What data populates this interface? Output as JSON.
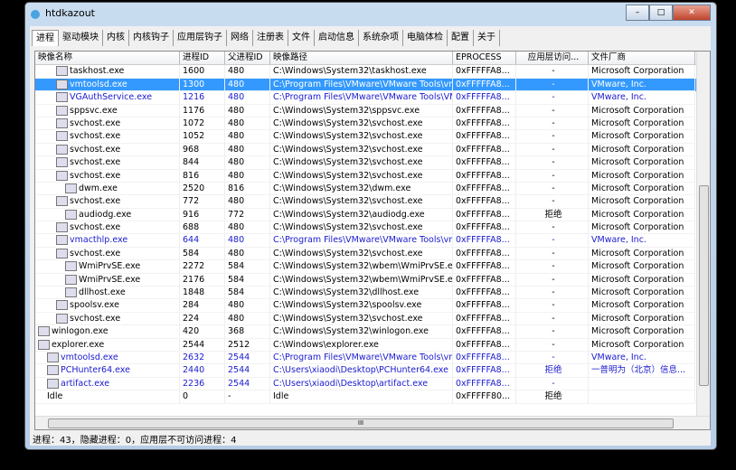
{
  "window": {
    "title": "htdkazout",
    "minimize": "–",
    "maximize": "□",
    "close": "✕"
  },
  "tabs": [
    "进程",
    "驱动模块",
    "内核",
    "内核钩子",
    "应用层钩子",
    "网络",
    "注册表",
    "文件",
    "启动信息",
    "系统杂项",
    "电脑体检",
    "配置",
    "关于"
  ],
  "columns": [
    "映像名称",
    "进程ID",
    "父进程ID",
    "映像路径",
    "EPROCESS",
    "应用层访问...",
    "文件厂商"
  ],
  "rows": [
    {
      "name": "taskhost.exe",
      "indent": 2,
      "pid": "1600",
      "ppid": "480",
      "path": "C:\\Windows\\System32\\taskhost.exe",
      "eprocess": "0xFFFFFA8...",
      "access": "-",
      "vendor": "Microsoft Corporation"
    },
    {
      "name": "vmtoolsd.exe",
      "indent": 2,
      "pid": "1300",
      "ppid": "480",
      "path": "C:\\Program Files\\VMware\\VMware Tools\\vmt...",
      "eprocess": "0xFFFFFA8...",
      "access": "-",
      "vendor": "VMware, Inc.",
      "selected": true
    },
    {
      "name": "VGAuthService.exe",
      "indent": 2,
      "pid": "1216",
      "ppid": "480",
      "path": "C:\\Program Files\\VMware\\VMware Tools\\VM...",
      "eprocess": "0xFFFFFA8...",
      "access": "-",
      "vendor": "VMware, Inc.",
      "blue": true
    },
    {
      "name": "sppsvc.exe",
      "indent": 2,
      "pid": "1176",
      "ppid": "480",
      "path": "C:\\Windows\\System32\\sppsvc.exe",
      "eprocess": "0xFFFFFA8...",
      "access": "-",
      "vendor": "Microsoft Corporation"
    },
    {
      "name": "svchost.exe",
      "indent": 2,
      "pid": "1072",
      "ppid": "480",
      "path": "C:\\Windows\\System32\\svchost.exe",
      "eprocess": "0xFFFFFA8...",
      "access": "-",
      "vendor": "Microsoft Corporation"
    },
    {
      "name": "svchost.exe",
      "indent": 2,
      "pid": "1052",
      "ppid": "480",
      "path": "C:\\Windows\\System32\\svchost.exe",
      "eprocess": "0xFFFFFA8...",
      "access": "-",
      "vendor": "Microsoft Corporation"
    },
    {
      "name": "svchost.exe",
      "indent": 2,
      "pid": "968",
      "ppid": "480",
      "path": "C:\\Windows\\System32\\svchost.exe",
      "eprocess": "0xFFFFFA8...",
      "access": "-",
      "vendor": "Microsoft Corporation"
    },
    {
      "name": "svchost.exe",
      "indent": 2,
      "pid": "844",
      "ppid": "480",
      "path": "C:\\Windows\\System32\\svchost.exe",
      "eprocess": "0xFFFFFA8...",
      "access": "-",
      "vendor": "Microsoft Corporation"
    },
    {
      "name": "svchost.exe",
      "indent": 2,
      "pid": "816",
      "ppid": "480",
      "path": "C:\\Windows\\System32\\svchost.exe",
      "eprocess": "0xFFFFFA8...",
      "access": "-",
      "vendor": "Microsoft Corporation"
    },
    {
      "name": "dwm.exe",
      "indent": 3,
      "pid": "2520",
      "ppid": "816",
      "path": "C:\\Windows\\System32\\dwm.exe",
      "eprocess": "0xFFFFFA8...",
      "access": "-",
      "vendor": "Microsoft Corporation"
    },
    {
      "name": "svchost.exe",
      "indent": 2,
      "pid": "772",
      "ppid": "480",
      "path": "C:\\Windows\\System32\\svchost.exe",
      "eprocess": "0xFFFFFA8...",
      "access": "-",
      "vendor": "Microsoft Corporation"
    },
    {
      "name": "audiodg.exe",
      "indent": 3,
      "pid": "916",
      "ppid": "772",
      "path": "C:\\Windows\\System32\\audiodg.exe",
      "eprocess": "0xFFFFFA8...",
      "access": "拒绝",
      "vendor": "Microsoft Corporation"
    },
    {
      "name": "svchost.exe",
      "indent": 2,
      "pid": "688",
      "ppid": "480",
      "path": "C:\\Windows\\System32\\svchost.exe",
      "eprocess": "0xFFFFFA8...",
      "access": "-",
      "vendor": "Microsoft Corporation"
    },
    {
      "name": "vmacthlp.exe",
      "indent": 2,
      "pid": "644",
      "ppid": "480",
      "path": "C:\\Program Files\\VMware\\VMware Tools\\vma...",
      "eprocess": "0xFFFFFA8...",
      "access": "-",
      "vendor": "VMware, Inc.",
      "blue": true
    },
    {
      "name": "svchost.exe",
      "indent": 2,
      "pid": "584",
      "ppid": "480",
      "path": "C:\\Windows\\System32\\svchost.exe",
      "eprocess": "0xFFFFFA8...",
      "access": "-",
      "vendor": "Microsoft Corporation"
    },
    {
      "name": "WmiPrvSE.exe",
      "indent": 3,
      "pid": "2272",
      "ppid": "584",
      "path": "C:\\Windows\\System32\\wbem\\WmiPrvSE.exe",
      "eprocess": "0xFFFFFA8...",
      "access": "-",
      "vendor": "Microsoft Corporation"
    },
    {
      "name": "WmiPrvSE.exe",
      "indent": 3,
      "pid": "2176",
      "ppid": "584",
      "path": "C:\\Windows\\System32\\wbem\\WmiPrvSE.exe",
      "eprocess": "0xFFFFFA8...",
      "access": "-",
      "vendor": "Microsoft Corporation"
    },
    {
      "name": "dllhost.exe",
      "indent": 3,
      "pid": "1848",
      "ppid": "584",
      "path": "C:\\Windows\\System32\\dllhost.exe",
      "eprocess": "0xFFFFFA8...",
      "access": "-",
      "vendor": "Microsoft Corporation"
    },
    {
      "name": "spoolsv.exe",
      "indent": 2,
      "pid": "284",
      "ppid": "480",
      "path": "C:\\Windows\\System32\\spoolsv.exe",
      "eprocess": "0xFFFFFA8...",
      "access": "-",
      "vendor": "Microsoft Corporation"
    },
    {
      "name": "svchost.exe",
      "indent": 2,
      "pid": "224",
      "ppid": "480",
      "path": "C:\\Windows\\System32\\svchost.exe",
      "eprocess": "0xFFFFFA8...",
      "access": "-",
      "vendor": "Microsoft Corporation"
    },
    {
      "name": "winlogon.exe",
      "indent": 0,
      "pid": "420",
      "ppid": "368",
      "path": "C:\\Windows\\System32\\winlogon.exe",
      "eprocess": "0xFFFFFA8...",
      "access": "-",
      "vendor": "Microsoft Corporation"
    },
    {
      "name": "explorer.exe",
      "indent": 0,
      "pid": "2544",
      "ppid": "2512",
      "path": "C:\\Windows\\explorer.exe",
      "eprocess": "0xFFFFFA8...",
      "access": "-",
      "vendor": "Microsoft Corporation"
    },
    {
      "name": "vmtoolsd.exe",
      "indent": 1,
      "pid": "2632",
      "ppid": "2544",
      "path": "C:\\Program Files\\VMware\\VMware Tools\\vmt...",
      "eprocess": "0xFFFFFA8...",
      "access": "-",
      "vendor": "VMware, Inc.",
      "blue": true
    },
    {
      "name": "PCHunter64.exe",
      "indent": 1,
      "pid": "2440",
      "ppid": "2544",
      "path": "C:\\Users\\xiaodi\\Desktop\\PCHunter64.exe",
      "eprocess": "0xFFFFFA8...",
      "access": "拒绝",
      "vendor": "一普明为（北京）信息...",
      "blue": true
    },
    {
      "name": "artifact.exe",
      "indent": 1,
      "pid": "2236",
      "ppid": "2544",
      "path": "C:\\Users\\xiaodi\\Desktop\\artifact.exe",
      "eprocess": "0xFFFFFA8...",
      "access": "-",
      "vendor": "",
      "blue": true
    },
    {
      "name": "Idle",
      "indent": 1,
      "pid": "0",
      "ppid": "-",
      "path": "Idle",
      "eprocess": "0xFFFFF80...",
      "access": "拒绝",
      "vendor": "",
      "noicon": true
    }
  ],
  "hscroll_grip": "III",
  "status": "进程：43，隐藏进程：0，应用层不可访问进程：4"
}
